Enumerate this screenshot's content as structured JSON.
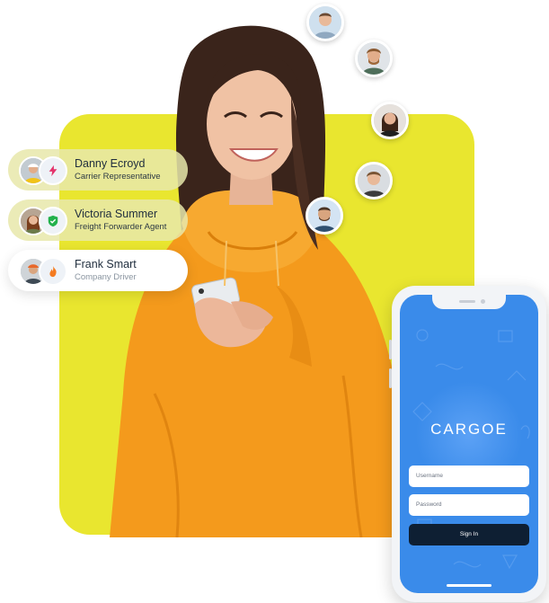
{
  "contacts": [
    {
      "name": "Danny Ecroyd",
      "role": "Carrier Representative",
      "badge_icon": "lightning-icon",
      "badge_color": "#e4336b"
    },
    {
      "name": "Victoria Summer",
      "role": "Freight Forwarder Agent",
      "badge_icon": "shield-check-icon",
      "badge_color": "#22b14c"
    },
    {
      "name": "Frank Smart",
      "role": "Company Driver",
      "badge_icon": "flame-icon",
      "badge_color": "#f47b20"
    }
  ],
  "phone": {
    "logo_text": "CARGOE",
    "username_placeholder": "Username",
    "password_placeholder": "Password",
    "signin_label": "Sign In"
  },
  "colors": {
    "panel_yellow": "#e9e62f",
    "screen_blue": "#3a8bea",
    "signin_navy": "#0e1f33",
    "hoodie_orange": "#f49a1c"
  }
}
